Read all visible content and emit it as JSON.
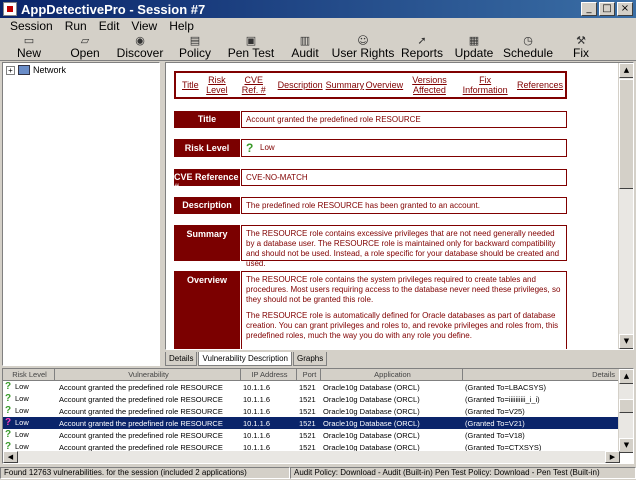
{
  "window": {
    "title": "AppDetectivePro - Session #7"
  },
  "menu": [
    "Session",
    "Run",
    "Edit",
    "View",
    "Help"
  ],
  "toolbar": [
    {
      "label": "New",
      "icon": "new-icon"
    },
    {
      "label": "Open",
      "icon": "open-icon"
    },
    {
      "label": "Discover",
      "icon": "discover-icon"
    },
    {
      "label": "Policy",
      "icon": "policy-icon"
    },
    {
      "label": "Pen Test",
      "icon": "pen-test-icon"
    },
    {
      "label": "Audit",
      "icon": "audit-icon"
    },
    {
      "label": "User Rights",
      "icon": "user-rights-icon"
    },
    {
      "label": "Reports",
      "icon": "reports-icon"
    },
    {
      "label": "Update",
      "icon": "update-icon"
    },
    {
      "label": "Schedule",
      "icon": "schedule-icon"
    },
    {
      "label": "Fix",
      "icon": "fix-icon"
    }
  ],
  "tree": {
    "root": "Network",
    "expander": "+"
  },
  "nav": [
    "Title",
    "Risk Level",
    "CVE Ref. #",
    "Description",
    "Summary",
    "Overview",
    "Versions Affected",
    "Fix Information",
    "References"
  ],
  "detail": {
    "title_label": "Title",
    "title_value": "Account granted the predefined role RESOURCE",
    "risk_label": "Risk Level",
    "risk_value": "Low",
    "cve_label": "CVE Reference #",
    "cve_value": "CVE-NO-MATCH",
    "desc_label": "Description",
    "desc_value": "The predefined role RESOURCE has been granted to an account.",
    "summary_label": "Summary",
    "summary_value": "The RESOURCE role contains excessive privileges that are not need generally needed by a database user. The RESOURCE role is maintained only for backward compatibility and should not be used. Instead, a role specific for your database should be created and used.",
    "overview_label": "Overview",
    "overview_p1": "The RESOURCE role contains the system privileges required to create tables and procedures. Most users requiring access to the database never need these privileges, so they should not be granted this role.",
    "overview_p2": "The RESOURCE role is automatically defined for Oracle databases as part of database creation. You can grant privileges and roles to, and revoke privileges and roles from, this predefined roles, much the way you do with any role you define."
  },
  "tabs": [
    "Details",
    "Vulnerability Description",
    "Graphs"
  ],
  "list": {
    "columns": [
      "Risk Level",
      "Vulnerability",
      "IP Address",
      "Port",
      "Application",
      "Details"
    ],
    "rows": [
      {
        "risk": "Low",
        "vuln": "Account granted the predefined role RESOURCE",
        "ip": "10.1.1.6",
        "port": "1521",
        "app": "Oracle10g Database (ORCL)",
        "details": "(Granted To=LBACSYS)"
      },
      {
        "risk": "Low",
        "vuln": "Account granted the predefined role RESOURCE",
        "ip": "10.1.1.6",
        "port": "1521",
        "app": "Oracle10g Database (ORCL)",
        "details": "(Granted To=iiiiiiiiii_i_i)"
      },
      {
        "risk": "Low",
        "vuln": "Account granted the predefined role RESOURCE",
        "ip": "10.1.1.6",
        "port": "1521",
        "app": "Oracle10g Database (ORCL)",
        "details": "(Granted To=V25)"
      },
      {
        "risk": "Low",
        "vuln": "Account granted the predefined role RESOURCE",
        "ip": "10.1.1.6",
        "port": "1521",
        "app": "Oracle10g Database (ORCL)",
        "details": "(Granted To=V21)"
      },
      {
        "risk": "Low",
        "vuln": "Account granted the predefined role RESOURCE",
        "ip": "10.1.1.6",
        "port": "1521",
        "app": "Oracle10g Database (ORCL)",
        "details": "(Granted To=V18)"
      },
      {
        "risk": "Low",
        "vuln": "Account granted the predefined role RESOURCE",
        "ip": "10.1.1.6",
        "port": "1521",
        "app": "Oracle10g Database (ORCL)",
        "details": "(Granted To=CTXSYS)"
      }
    ],
    "selected_index": 3
  },
  "status": {
    "left": "Found 12763 vulnerabilities. for the session (included 2 applications)",
    "right": "Audit Policy: Download - Audit (Built-in) Pen Test Policy: Download - Pen Test (Built-in)"
  },
  "colors": {
    "accent": "#7b0000",
    "title_bar": "#0a246a",
    "selection": "#0a246a",
    "low_risk": "#3a9a2a"
  }
}
